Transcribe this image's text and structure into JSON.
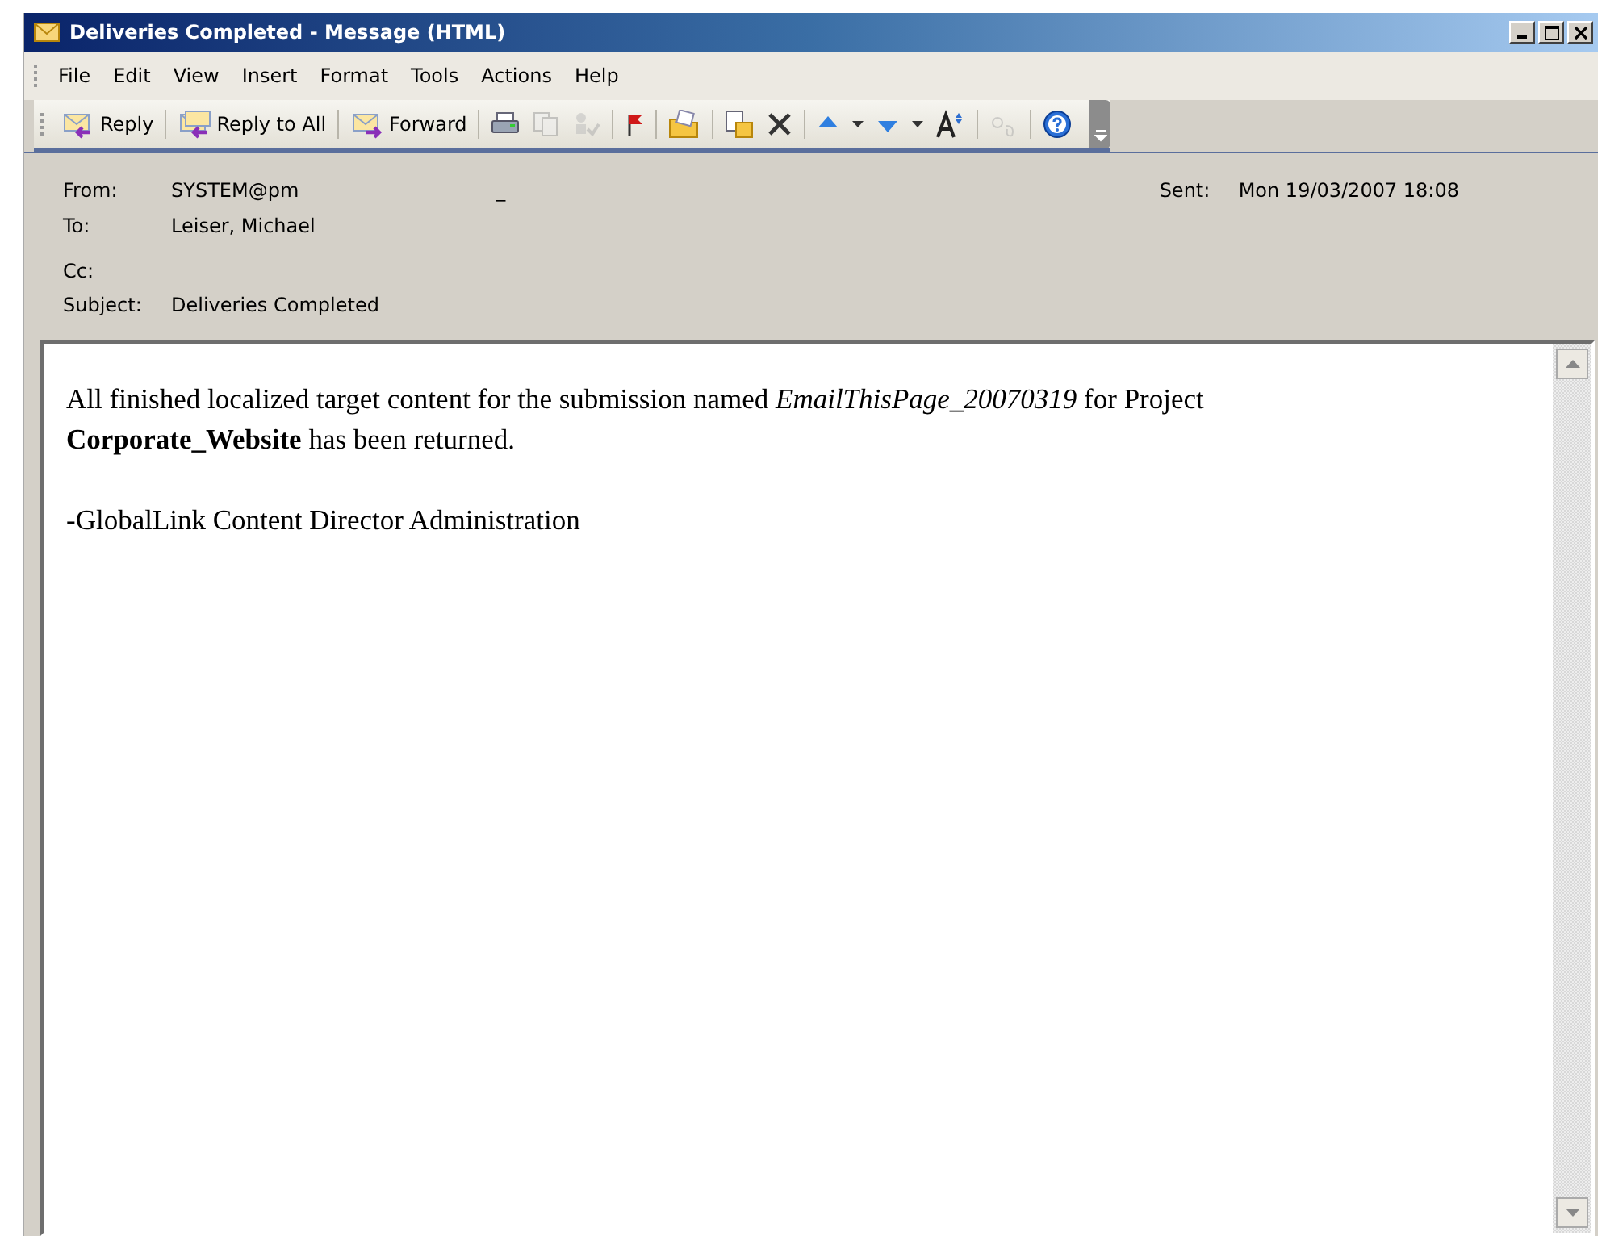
{
  "window": {
    "title": "Deliveries Completed - Message (HTML)"
  },
  "menu": [
    "File",
    "Edit",
    "View",
    "Insert",
    "Format",
    "Tools",
    "Actions",
    "Help"
  ],
  "toolbar": [
    {
      "kind": "labeled",
      "label": "Reply",
      "disabled": false
    },
    {
      "kind": "separator"
    },
    {
      "kind": "labeled",
      "label": "Reply to All",
      "disabled": false
    },
    {
      "kind": "separator"
    },
    {
      "kind": "labeled",
      "label": "Forward",
      "disabled": false
    },
    {
      "kind": "separator"
    },
    {
      "kind": "icon",
      "disabled": false
    },
    {
      "kind": "icon",
      "disabled": true
    },
    {
      "kind": "icon",
      "disabled": true
    },
    {
      "kind": "separator"
    },
    {
      "kind": "icon",
      "disabled": false
    },
    {
      "kind": "separator"
    },
    {
      "kind": "icon",
      "disabled": false
    },
    {
      "kind": "separator"
    },
    {
      "kind": "icon",
      "disabled": false
    },
    {
      "kind": "icon",
      "disabled": false
    },
    {
      "kind": "separator"
    },
    {
      "kind": "icon",
      "disabled": false
    },
    {
      "kind": "icon",
      "disabled": false
    },
    {
      "kind": "icon",
      "disabled": false
    },
    {
      "kind": "icon",
      "disabled": false
    },
    {
      "kind": "icon",
      "disabled": false
    },
    {
      "kind": "separator"
    },
    {
      "kind": "icon",
      "disabled": true
    },
    {
      "kind": "separator"
    },
    {
      "kind": "icon",
      "disabled": false
    }
  ],
  "header": {
    "from_label": "From:",
    "from": "SYSTEM@pm",
    "from_mark": "_",
    "sent_label": "Sent:",
    "sent": "Mon 19/03/2007 18:08",
    "to_label": "To:",
    "to": "Leiser, Michael",
    "cc_label": "Cc:",
    "subject_label": "Subject:",
    "subject": "Deliveries Completed"
  },
  "body": [
    "All finished localized target content for the submission named *EmailThisPage_20070319* for Project **Corporate_Website** has been returned.",
    "-GlobalLink Content Director Administration"
  ]
}
